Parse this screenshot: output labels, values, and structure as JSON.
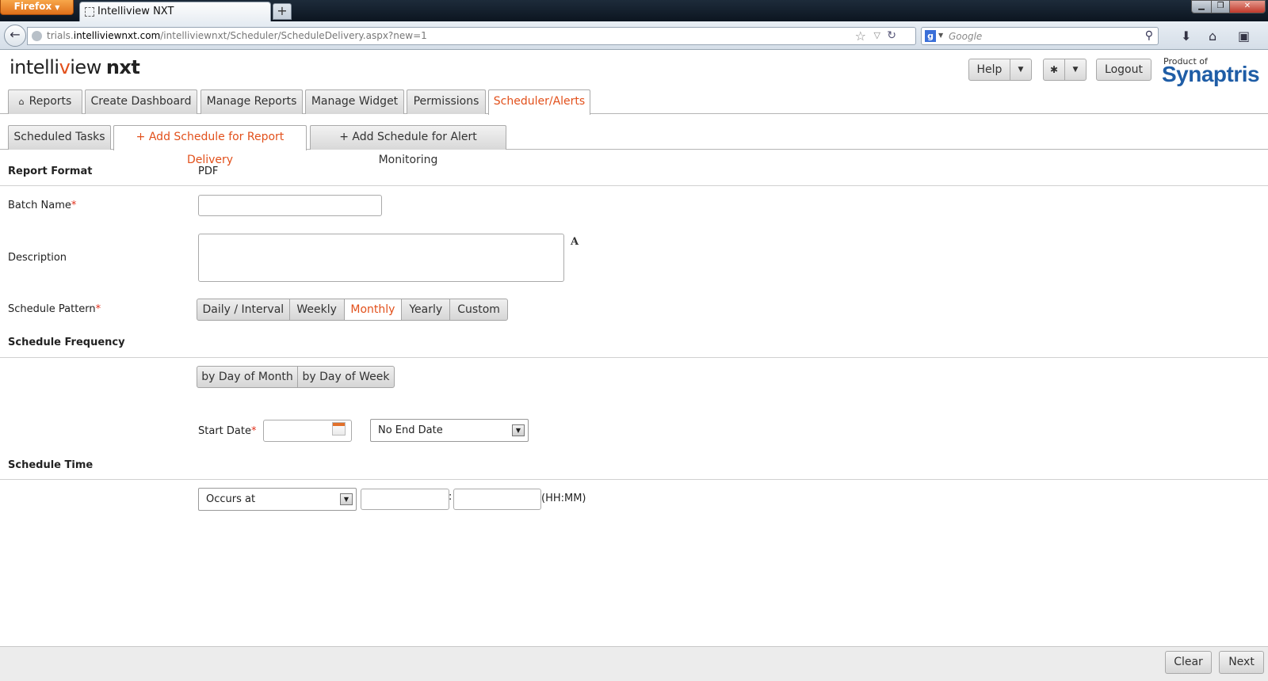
{
  "browser": {
    "firefox_label": "Firefox",
    "tab_title": "Intelliview NXT",
    "new_tab_glyph": "+",
    "url_prefix": "trials.",
    "url_domain": "intelliviewnxt.com",
    "url_path": "/intelliviewnxt/Scheduler/ScheduleDelivery.aspx?new=1",
    "search_placeholder": "Google",
    "search_engine_letter": "g",
    "icons": [
      "back-arrow-icon",
      "globe-icon",
      "star-icon",
      "reload-icon",
      "search-icon",
      "download-icon",
      "home-icon",
      "bookmarks-icon"
    ]
  },
  "header": {
    "logo_part1": "intelli",
    "logo_o": "v",
    "logo_part2": "iew",
    "logo_nxt": "nxt",
    "help_label": "Help",
    "logout_label": "Logout",
    "product_of": "Product of",
    "brand": "Synaptris",
    "accent_color": "#e2501b",
    "brand_color": "#1f5da6"
  },
  "main_tabs": [
    {
      "label": "Reports"
    },
    {
      "label": "Create Dashboard"
    },
    {
      "label": "Manage Reports"
    },
    {
      "label": "Manage Widget"
    },
    {
      "label": "Permissions"
    },
    {
      "label": "Scheduler/Alerts",
      "active": true
    }
  ],
  "sub_tabs": [
    {
      "label": "Scheduled Tasks"
    },
    {
      "label": "+ Add Schedule for Report Delivery",
      "active": true
    },
    {
      "label": "+ Add Schedule for Alert Monitoring"
    }
  ],
  "form": {
    "report_format_label": "Report Format",
    "report_format_value": "PDF",
    "batch_name_label": "Batch Name",
    "batch_name_value": "",
    "description_label": "Description",
    "description_value": "",
    "rte_glyph": "A",
    "schedule_pattern_label": "Schedule Pattern",
    "required_mark": "*",
    "patterns": [
      {
        "label": "Daily / Interval"
      },
      {
        "label": "Weekly"
      },
      {
        "label": "Monthly",
        "active": true
      },
      {
        "label": "Yearly"
      },
      {
        "label": "Custom"
      }
    ],
    "schedule_frequency_label": "Schedule Frequency",
    "frequency_modes": [
      {
        "label": "by Day of Month"
      },
      {
        "label": "by Day of Week"
      }
    ],
    "start_date_label": "Start Date",
    "start_date_value": "",
    "end_date_option": "No End Date",
    "schedule_time_label": "Schedule Time",
    "occurs_option": "Occurs at",
    "hour_value": "",
    "minute_value": "",
    "time_separator": ":",
    "time_format_hint": "(HH:MM)"
  },
  "footer": {
    "clear_label": "Clear",
    "next_label": "Next"
  }
}
